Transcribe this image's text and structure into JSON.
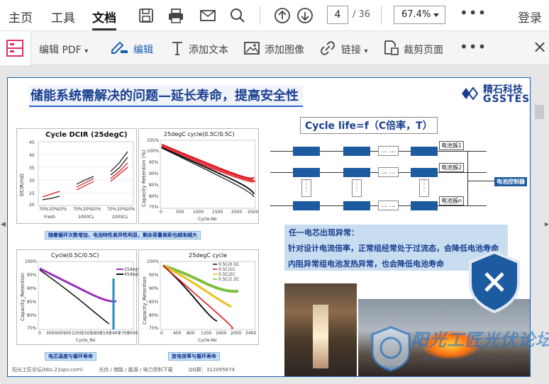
{
  "toolbar": {
    "menu_home": "主页",
    "menu_tools": "工具",
    "menu_document": "文档",
    "page_current": "4",
    "page_total": "/ 36",
    "zoom": "67.4%",
    "login": "登录",
    "icons": [
      "save-icon",
      "print-icon",
      "mail-icon",
      "search-icon",
      "page-up-icon",
      "page-down-icon",
      "more-icon"
    ]
  },
  "edit_toolbar": {
    "edit_pdf": "编辑 PDF",
    "edit": "编辑",
    "add_text": "添加文本",
    "add_image": "添加图像",
    "link": "链接",
    "crop": "裁剪页面",
    "close": "×"
  },
  "slide": {
    "title": "储能系统需解决的问题—延长寿命，提高安全性",
    "logo_cn": "精石科技",
    "logo_en": "GSSTES",
    "chart1": {
      "title": "Cycle DCIR (25degC)",
      "ylabel": "DCIR/mΩ",
      "yticks": [
        "45",
        "40",
        "35",
        "30",
        "25",
        "20"
      ],
      "xticks": [
        "70%",
        "20%",
        "10%",
        "70%",
        "20%",
        "10%",
        "70%",
        "20%",
        "10%"
      ],
      "groups": [
        "Fresh",
        "1000CL",
        "2000CL"
      ]
    },
    "chart2": {
      "title": "25degC cycle(0.5C/0.5C)",
      "ylabel": "Capacity Retention (%)",
      "xlabel": "Cycle-No",
      "yticks": [
        "105%",
        "100%",
        "95%",
        "90%",
        "85%",
        "80%",
        "75%"
      ],
      "xticks": [
        "0",
        "500",
        "1000",
        "1500",
        "2000",
        "2500"
      ]
    },
    "caption1": "随着循环次数增加，电池特性差异性明显，剩余容量差距也越来越大",
    "chart3": {
      "title": "Cycle(0.5C/0.5C)",
      "ylabel": "Capacity_Retention",
      "xlabel": "Cycle_No",
      "legend": [
        "25degC",
        "45degC"
      ],
      "yticks": [
        "100%",
        "95%",
        "90%",
        "85%",
        "80%",
        "75%"
      ],
      "xticks": [
        "0",
        "300",
        "600",
        "900",
        "1200",
        "1500",
        "1800",
        "2100",
        "2400",
        "2700",
        "3000"
      ]
    },
    "chart4": {
      "title": "25degC cycle",
      "ylabel": "Capacity_Retention",
      "xlabel": "Cycle-No",
      "legend": [
        "0.5C/0.5C",
        "0.5C/1C",
        "0.5C/2C",
        "0.5C/1.5C"
      ],
      "yticks": [
        "100%",
        "95%",
        "90%",
        "85%",
        "80%",
        "75%"
      ],
      "xticks": [
        "0",
        "400",
        "800",
        "1200",
        "1600",
        "2000",
        "2400"
      ]
    },
    "caption2": "电芯温度与循环寿命",
    "caption3": "放电倍率与循环寿命",
    "formula": "Cycle life=f（C倍率，T）",
    "dots": "… …",
    "clusters": [
      "电池簇1",
      "电池簇2",
      "电池簇n"
    ],
    "bms": "电池控制器",
    "warnings": [
      "任一电芯出现异常：",
      "针对设计电流倍率，正常组经常处于过流态，会降低电池寿命",
      "内阻异常组电池发热异常，也会降低电池寿命"
    ],
    "footer": [
      "阳光工匠论坛(bbs.21spv.com)",
      "光伏 / 储能 / 能源 / 电力资料下载",
      "QQ群：312095674"
    ]
  },
  "watermark": {
    "text": "阳光工匠光伏论坛",
    "sub": "BBS.21SPV.COM",
    "year": "2007"
  },
  "colors": {
    "accent": "#1d5ba0",
    "title": "#1a3f8f",
    "red": "#e0101a",
    "warn": "#c9ddf1"
  }
}
